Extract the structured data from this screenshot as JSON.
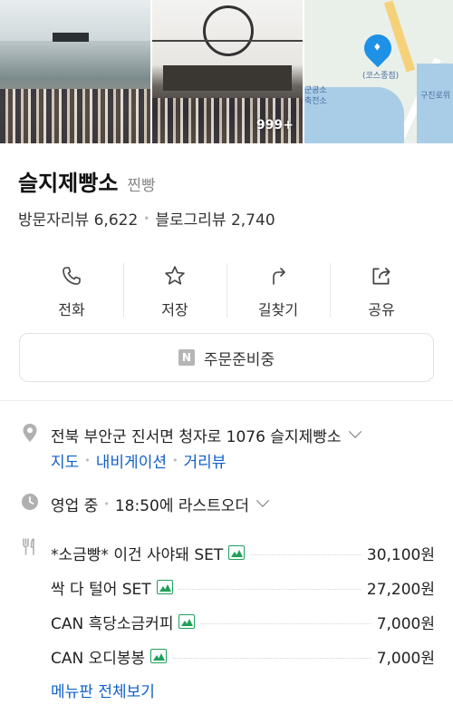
{
  "photos": {
    "count_badge": "999+",
    "map_labels": {
      "pin_label": "(코스종점)",
      "left_1": "군공소",
      "left_2": "축전소",
      "right_1": "구진로위"
    }
  },
  "place": {
    "name": "슬지제빵소",
    "category": "찐빵",
    "visitor_reviews": "방문자리뷰 6,622",
    "blog_reviews": "블로그리뷰 2,740"
  },
  "actions": [
    {
      "label": "전화",
      "icon": "phone-icon"
    },
    {
      "label": "저장",
      "icon": "star-icon"
    },
    {
      "label": "길찾기",
      "icon": "directions-icon"
    },
    {
      "label": "공유",
      "icon": "share-icon"
    }
  ],
  "order": {
    "badge": "N",
    "label": "주문준비중"
  },
  "address": {
    "text": "전북 부안군 진서면 청자로 1076 슬지제빵소",
    "links": [
      "지도",
      "내비게이션",
      "거리뷰"
    ]
  },
  "hours": {
    "status": "영업 중",
    "detail": "18:50에 라스트오더"
  },
  "menu": {
    "items": [
      {
        "name": "*소금빵* 이건 사야돼 SET",
        "price": "30,100원"
      },
      {
        "name": "싹 다 털어 SET",
        "price": "27,200원"
      },
      {
        "name": "CAN 흑당소금커피",
        "price": "7,000원"
      },
      {
        "name": "CAN 오디봉봉",
        "price": "7,000원"
      }
    ],
    "view_all": "메뉴판 전체보기"
  },
  "colors": {
    "link": "#0f60c8",
    "image_icon": "#1fa05a",
    "map_pin": "#1e90e6"
  }
}
